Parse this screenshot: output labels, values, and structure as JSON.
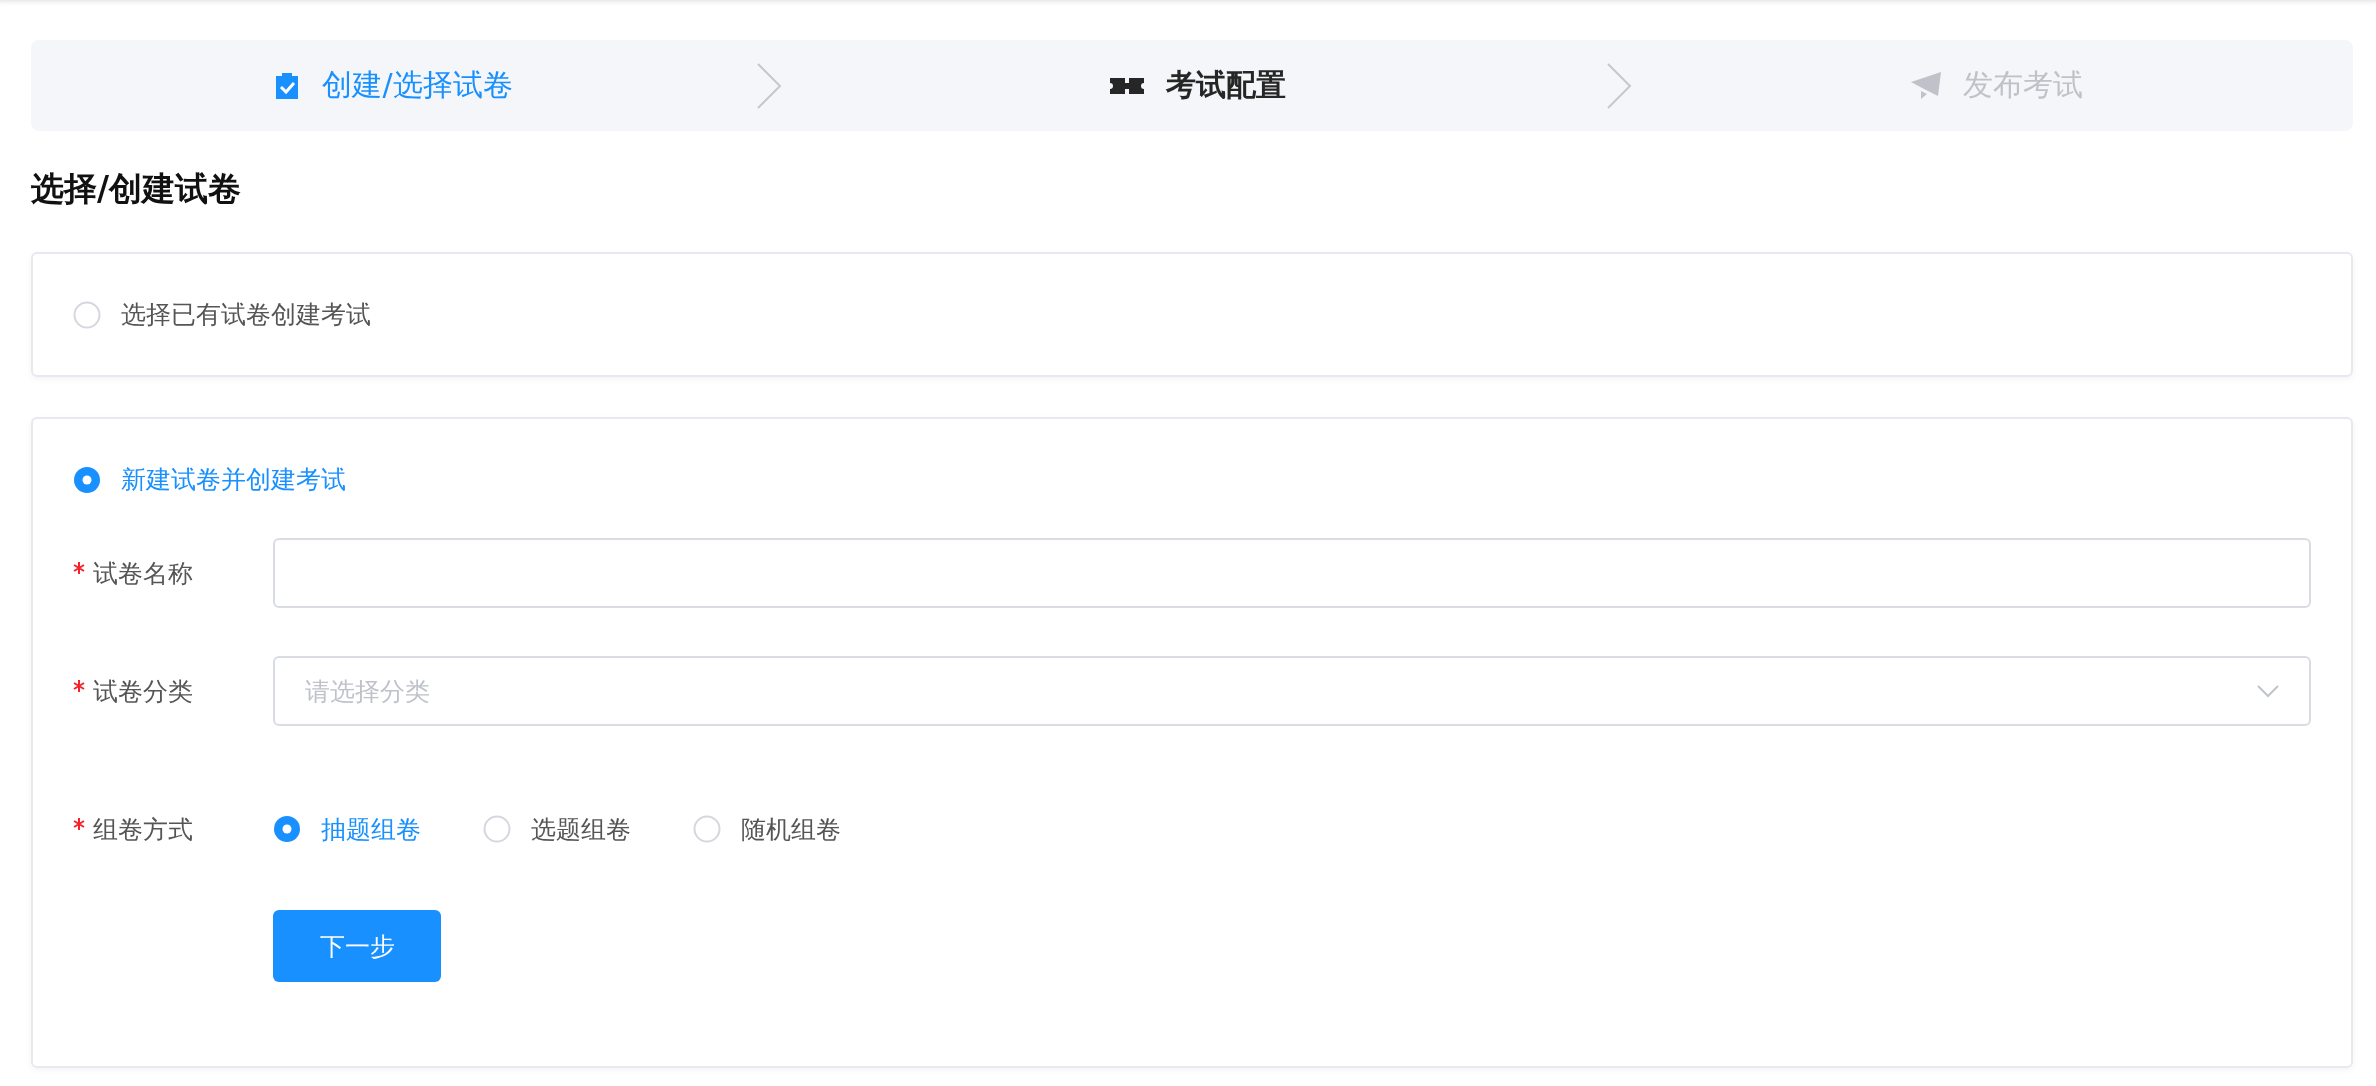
{
  "steps": [
    {
      "label": "创建/选择试卷",
      "completed": true,
      "selected": false
    },
    {
      "label": "考试配置",
      "completed": false,
      "selected": true
    },
    {
      "label": "发布考试",
      "completed": false,
      "selected": false
    }
  ],
  "heading": "选择/创建试卷",
  "source_options": [
    {
      "label": "选择已有试卷创建考试",
      "selected": false
    },
    {
      "label": "新建试卷并创建考试",
      "selected": true,
      "form": {
        "fields": [
          {
            "kind": "text",
            "label": "试卷名称",
            "required": true
          },
          {
            "kind": "select",
            "label": "试卷分类",
            "required": true,
            "placeholder": "请选择分类"
          },
          {
            "kind": "radio",
            "label": "组卷方式",
            "required": true,
            "options": [
              {
                "label": "抽题组卷",
                "selected": true
              },
              {
                "label": "选题组卷",
                "selected": false
              },
              {
                "label": "随机组卷",
                "selected": false
              }
            ]
          }
        ],
        "submit": "下一步"
      }
    }
  ]
}
